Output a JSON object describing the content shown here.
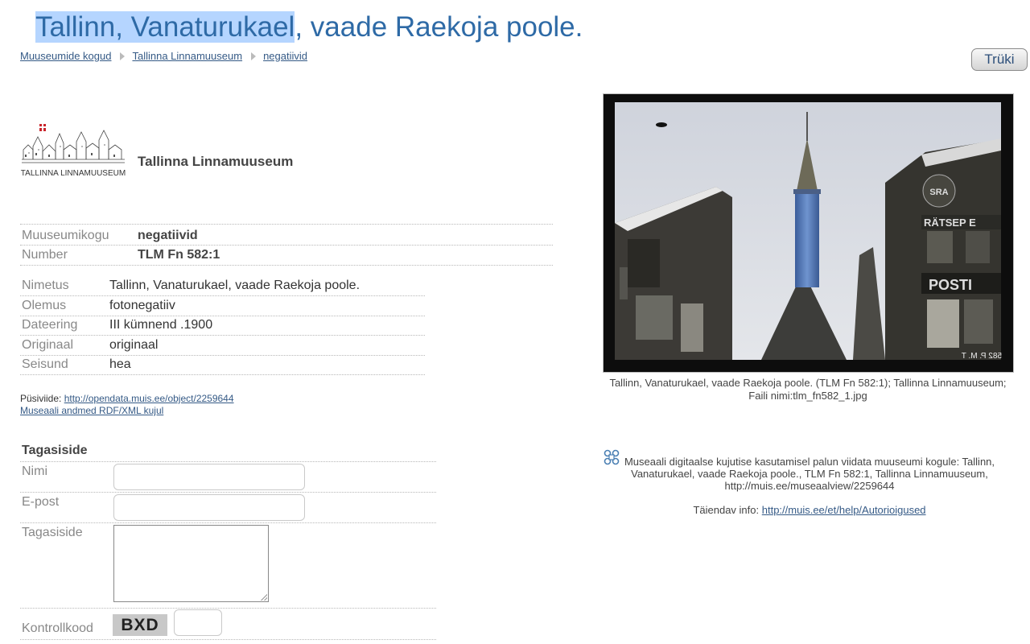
{
  "title": {
    "selected": "Tallinn, Vanaturukael",
    "rest": ", vaade Raekoja poole."
  },
  "breadcrumb": [
    "Muuseumide kogud",
    "Tallinna Linnamuuseum",
    "negatiivid"
  ],
  "print_button": "Trüki",
  "museum": {
    "name": "Tallinna Linnamuuseum",
    "logo_text": "TALLINNA LINNAMUUSEUM"
  },
  "collection": {
    "label": "Muuseumikogu",
    "value": "negatiivid"
  },
  "number": {
    "label": "Number",
    "value": "TLM Fn 582:1"
  },
  "details": [
    {
      "label": "Nimetus",
      "value": "Tallinn, Vanaturukael, vaade Raekoja poole."
    },
    {
      "label": "Olemus",
      "value": "fotonegatiiv"
    },
    {
      "label": "Dateering",
      "value": "III kümnend .1900"
    },
    {
      "label": "Originaal",
      "value": "originaal"
    },
    {
      "label": "Seisund",
      "value": "hea"
    }
  ],
  "permalink": {
    "label": "Püsiviide:",
    "url": "http://opendata.muis.ee/object/2259644"
  },
  "rdf_link": "Museaali andmed RDF/XML kujul",
  "feedback": {
    "title": "Tagasiside",
    "name_label": "Nimi",
    "email_label": "E-post",
    "message_label": "Tagasiside",
    "captcha_label": "Kontrollkood",
    "captcha_code": "BXD"
  },
  "photo": {
    "caption": "Tallinn, Vanaturukael, vaade Raekoja poole. (TLM Fn 582:1); Tallinna Linnamuuseum; Faili nimi:tlm_fn582_1.jpg",
    "sign_text_1": "RÄTSEP E",
    "sign_text_2": "POSTI",
    "sign_text_3": "SRA",
    "negative_mark": "582 P. M. T"
  },
  "license": {
    "text": "Museaali digitaalse kujutise kasutamisel palun viidata muuseumi kogule: Tallinn, Vanaturukael, vaade Raekoja poole., TLM Fn 582:1, Tallinna Linnamuuseum, http://muis.ee/museaalview/2259644",
    "extra_label": "Täiendav info:",
    "extra_url": "http://muis.ee/et/help/Autorioigused"
  },
  "colors": {
    "title": "#2e6aa6",
    "link": "#355a86",
    "selection": "#b5d5ff"
  }
}
